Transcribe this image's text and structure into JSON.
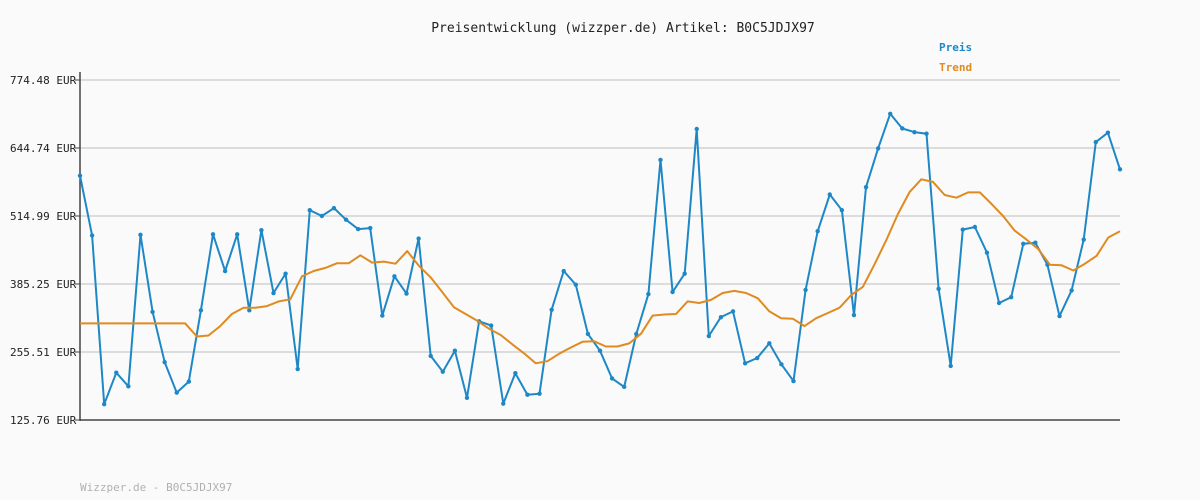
{
  "chart_data": {
    "type": "line",
    "title": "Preisentwicklung (wizzper.de) Artikel: B0C5JDJX97",
    "footer": "Wizzper.de - B0C5JDJX97",
    "y_ticks": [
      "774.48 EUR",
      "644.74 EUR",
      "514.99 EUR",
      "385.25 EUR",
      "255.51 EUR",
      "125.76 EUR"
    ],
    "y_tick_values": [
      774.48,
      644.74,
      514.99,
      385.25,
      255.51,
      125.76
    ],
    "ylim": [
      125.76,
      774.48
    ],
    "grid": true,
    "legend_position": "top-right",
    "series": [
      {
        "name": "Preis",
        "color": "#1e88c7",
        "values": [
          592,
          478,
          156,
          216,
          190,
          479,
          332,
          236,
          178,
          199,
          335,
          480,
          410,
          480,
          335,
          488,
          368,
          405,
          223,
          526,
          515,
          530,
          508,
          490,
          492,
          325,
          400,
          367,
          472,
          248,
          218,
          258,
          168,
          314,
          306,
          157,
          215,
          174,
          176,
          336,
          410,
          384,
          290,
          258,
          205,
          189,
          290,
          366,
          622,
          370,
          405,
          681,
          286,
          322,
          333,
          234,
          244,
          272,
          232,
          200,
          374,
          486,
          556,
          526,
          326,
          570,
          644,
          710,
          682,
          675,
          672,
          376,
          229,
          489,
          494,
          445,
          349,
          360,
          462,
          464,
          422,
          324,
          373,
          470,
          656,
          674,
          604
        ]
      },
      {
        "name": "Trend",
        "color": "#e08a1f",
        "values": [
          310,
          310,
          310,
          310,
          310,
          310,
          310,
          310,
          310,
          310,
          285,
          287,
          305,
          328,
          340,
          340,
          343,
          352,
          356,
          400,
          410,
          416,
          425,
          425,
          440,
          426,
          428,
          424,
          448,
          420,
          398,
          370,
          341,
          328,
          315,
          300,
          288,
          270,
          253,
          234,
          238,
          252,
          264,
          275,
          276,
          266,
          266,
          272,
          290,
          325,
          327,
          328,
          352,
          349,
          355,
          368,
          372,
          368,
          358,
          333,
          320,
          319,
          305,
          320,
          330,
          340,
          364,
          380,
          423,
          469,
          519,
          561,
          585,
          580,
          555,
          550,
          560,
          560,
          538,
          515,
          487,
          470,
          452,
          422,
          421,
          411,
          424,
          439,
          474,
          486
        ]
      }
    ]
  }
}
